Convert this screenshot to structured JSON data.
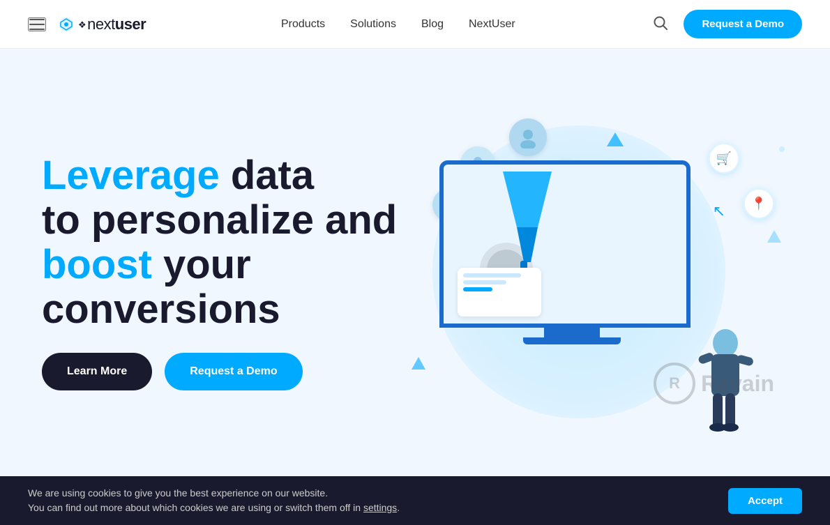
{
  "notification_dot": "",
  "header": {
    "hamburger_label": "menu",
    "logo_text": "nextuser",
    "nav": {
      "products": "Products",
      "solutions": "Solutions",
      "blog": "Blog",
      "nextuser": "NextUser"
    },
    "search_label": "search",
    "cta_label": "Request a Demo"
  },
  "hero": {
    "title_part1": "Leverage",
    "title_part2": " data",
    "title_part3": "to personalize and",
    "title_part4": "boost",
    "title_part5": " your",
    "title_part6": "conversions",
    "btn_learn_more": "Learn More",
    "btn_request_demo": "Request a Demo"
  },
  "cookie": {
    "message": "We are using cookies to give you the best experience on our website.\nYou can find out more about which cookies we are using or switch them off in",
    "settings_link": "settings",
    "accept_label": "Accept"
  },
  "revain": {
    "logo_letter": "R",
    "brand": "Revain"
  }
}
